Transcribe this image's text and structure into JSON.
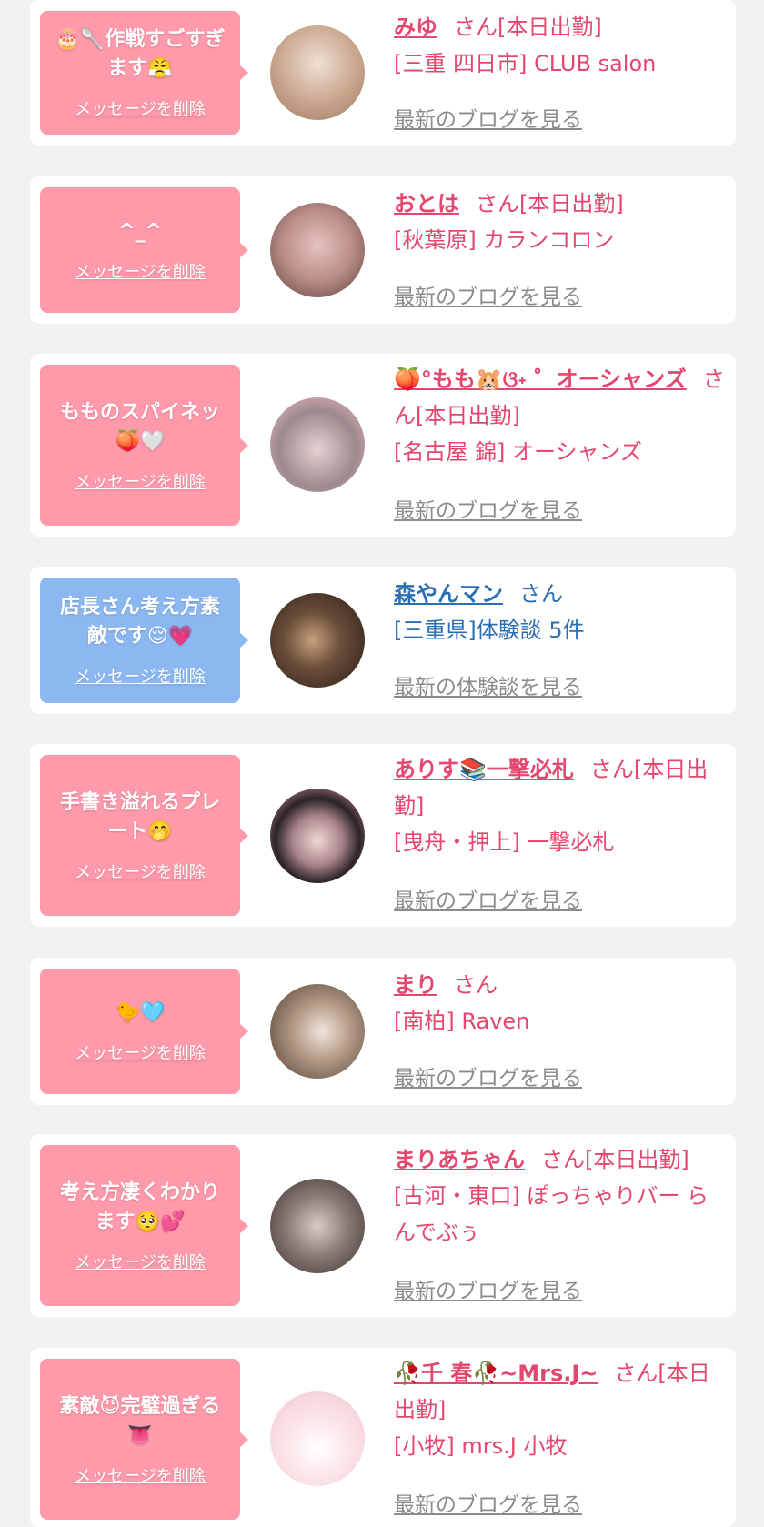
{
  "messages": [
    {
      "message": "🎂🥄作戦すごすぎます😤",
      "delete_label": "メッセージを削除",
      "name": "みゆ",
      "suffix": "さん[本日出勤]",
      "shop": "[三重 四日市] CLUB salon",
      "more_label": "最新のブログを見る",
      "bubble_color": "pink",
      "avatar_colors": [
        "#e9d6c9",
        "#b98a6a"
      ]
    },
    {
      "message": "^_^",
      "delete_label": "メッセージを削除",
      "name": "おとは",
      "suffix": "さん[本日出勤]",
      "shop": "[秋葉原] カランコロン",
      "more_label": "最新のブログを見る",
      "bubble_color": "pink",
      "avatar_colors": [
        "#cfa8a8",
        "#5a3e3a"
      ]
    },
    {
      "message": "もものスパイネッ🍑🤍",
      "delete_label": "メッセージを削除",
      "name": "🍑°もも🐹ଓ˖ ゜オーシャンズ",
      "suffix": "さん[本日出勤]",
      "shop": "[名古屋 錦] オーシャンズ",
      "more_label": "最新のブログを見る",
      "bubble_color": "pink",
      "avatar_colors": [
        "#f6b9c4",
        "#4a4a55"
      ]
    },
    {
      "message": "店長さん考え方素敵です😌💗",
      "delete_label": "メッセージを削除",
      "name": "森やんマン",
      "suffix": "さん",
      "shop": "[三重県]体験談 5件",
      "more_label": "最新の体験談を見る",
      "bubble_color": "blue",
      "avatar_colors": [
        "#3a2a22",
        "#c7a07a"
      ]
    },
    {
      "message": "手書き溢れるプレート🤭",
      "delete_label": "メッセージを削除",
      "name": "ありす📚一撃必札",
      "suffix": "さん[本日出勤]",
      "shop": "[曳舟・押上] 一撃必札",
      "more_label": "最新のブログを見る",
      "bubble_color": "pink",
      "avatar_colors": [
        "#f1a8ae",
        "#2b2328"
      ]
    },
    {
      "message": "🐤🩵",
      "delete_label": "メッセージを削除",
      "name": "まり",
      "suffix": "さん",
      "shop": "[南柏] Raven",
      "more_label": "最新のブログを見る",
      "bubble_color": "pink",
      "avatar_colors": [
        "#d9c4b4",
        "#5a4535"
      ]
    },
    {
      "message": "考え方凄くわかります🥺💕",
      "delete_label": "メッセージを削除",
      "name": "まりあちゃん",
      "suffix": "さん[本日出勤]",
      "shop": "[古河・東口] ぽっちゃりバー らんでぶぅ",
      "more_label": "最新のブログを見る",
      "bubble_color": "pink",
      "avatar_colors": [
        "#b8aaa6",
        "#4a3f3d"
      ]
    },
    {
      "message": "素敵😈完璧過ぎる👅",
      "delete_label": "メッセージを削除",
      "name": "🥀千 春🥀~Mrs.J~",
      "suffix": "さん[本日出勤]",
      "shop": "[小牧] mrs.J 小牧",
      "more_label": "最新のブログを見る",
      "bubble_color": "pink",
      "avatar_colors": [
        "#f7d4dc",
        "#ffffff"
      ]
    }
  ]
}
